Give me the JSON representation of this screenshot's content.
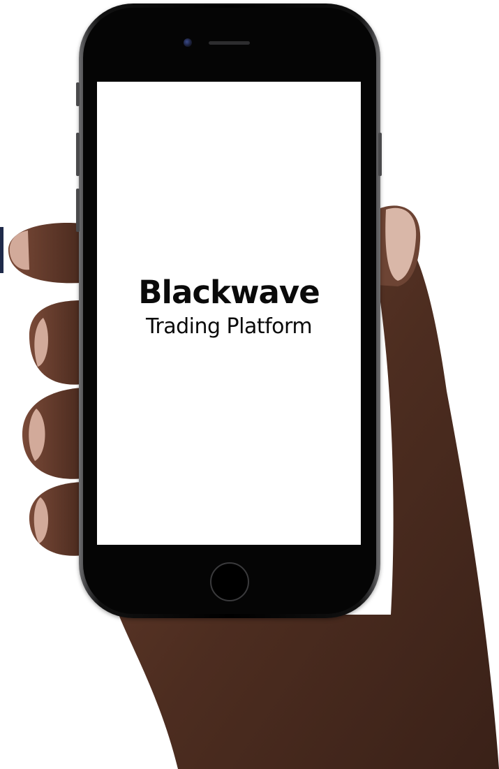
{
  "screen": {
    "brand_name": "Blackwave",
    "tagline": "Trading Platform",
    "background_color": "#ffffff",
    "text_color": "#0a0a0a"
  },
  "device": {
    "icons": [
      "camera-icon",
      "speaker-grille-icon",
      "home-button-icon"
    ]
  },
  "colors": {
    "skin": "#5a3628",
    "nail": "#d9b7a8",
    "phone_body": "#000000",
    "edge_mark": "#1f2a4a"
  }
}
